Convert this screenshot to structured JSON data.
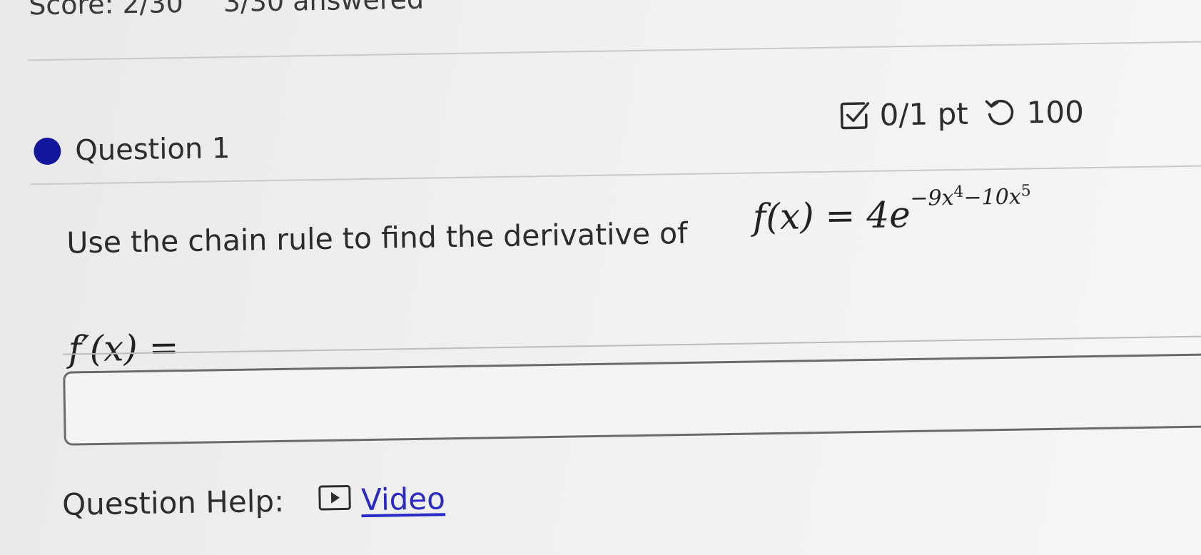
{
  "score_bar": {
    "score": "Score: 2/30",
    "answered": "3/30 answered"
  },
  "question": {
    "title": "Question 1",
    "points": "0/1 pt",
    "attempts": "100",
    "points_icon": "checkbox-pencil-icon",
    "attempts_icon": "retry-icon",
    "status_color": "#12169c"
  },
  "prompt": {
    "text": "Use the chain rule to find the derivative of"
  },
  "formula": {
    "lhs": "f(x) = 4e",
    "exponent_a": "−9x",
    "exponent_a_power": "4",
    "exponent_b": "−10x",
    "exponent_b_power": "5"
  },
  "answer": {
    "label": "f′(x) =",
    "value": ""
  },
  "help": {
    "label": "Question Help:",
    "video_label": "Video",
    "video_icon": "play-icon",
    "link_color": "#2a2ac7"
  }
}
